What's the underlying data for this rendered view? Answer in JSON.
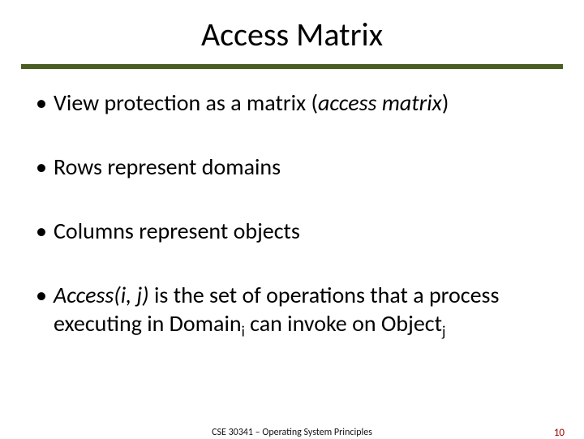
{
  "title": "Access Matrix",
  "bullets": {
    "b1": {
      "marker": "•",
      "t1": "View protection as a matrix (",
      "em": "access matrix",
      "t2": ")"
    },
    "b2": {
      "marker": "•",
      "t1": "Rows represent domains"
    },
    "b3": {
      "marker": "•",
      "t1": "Columns represent objects"
    },
    "b4": {
      "marker": "•",
      "em1": "Access(i, j)",
      "t1": " is the set of operations that a process executing in Domain",
      "sub1": "i",
      "t2": " can invoke on Object",
      "sub2": "j"
    }
  },
  "footer": {
    "course": "CSE 30341 – Operating System Principles",
    "page": "10"
  }
}
